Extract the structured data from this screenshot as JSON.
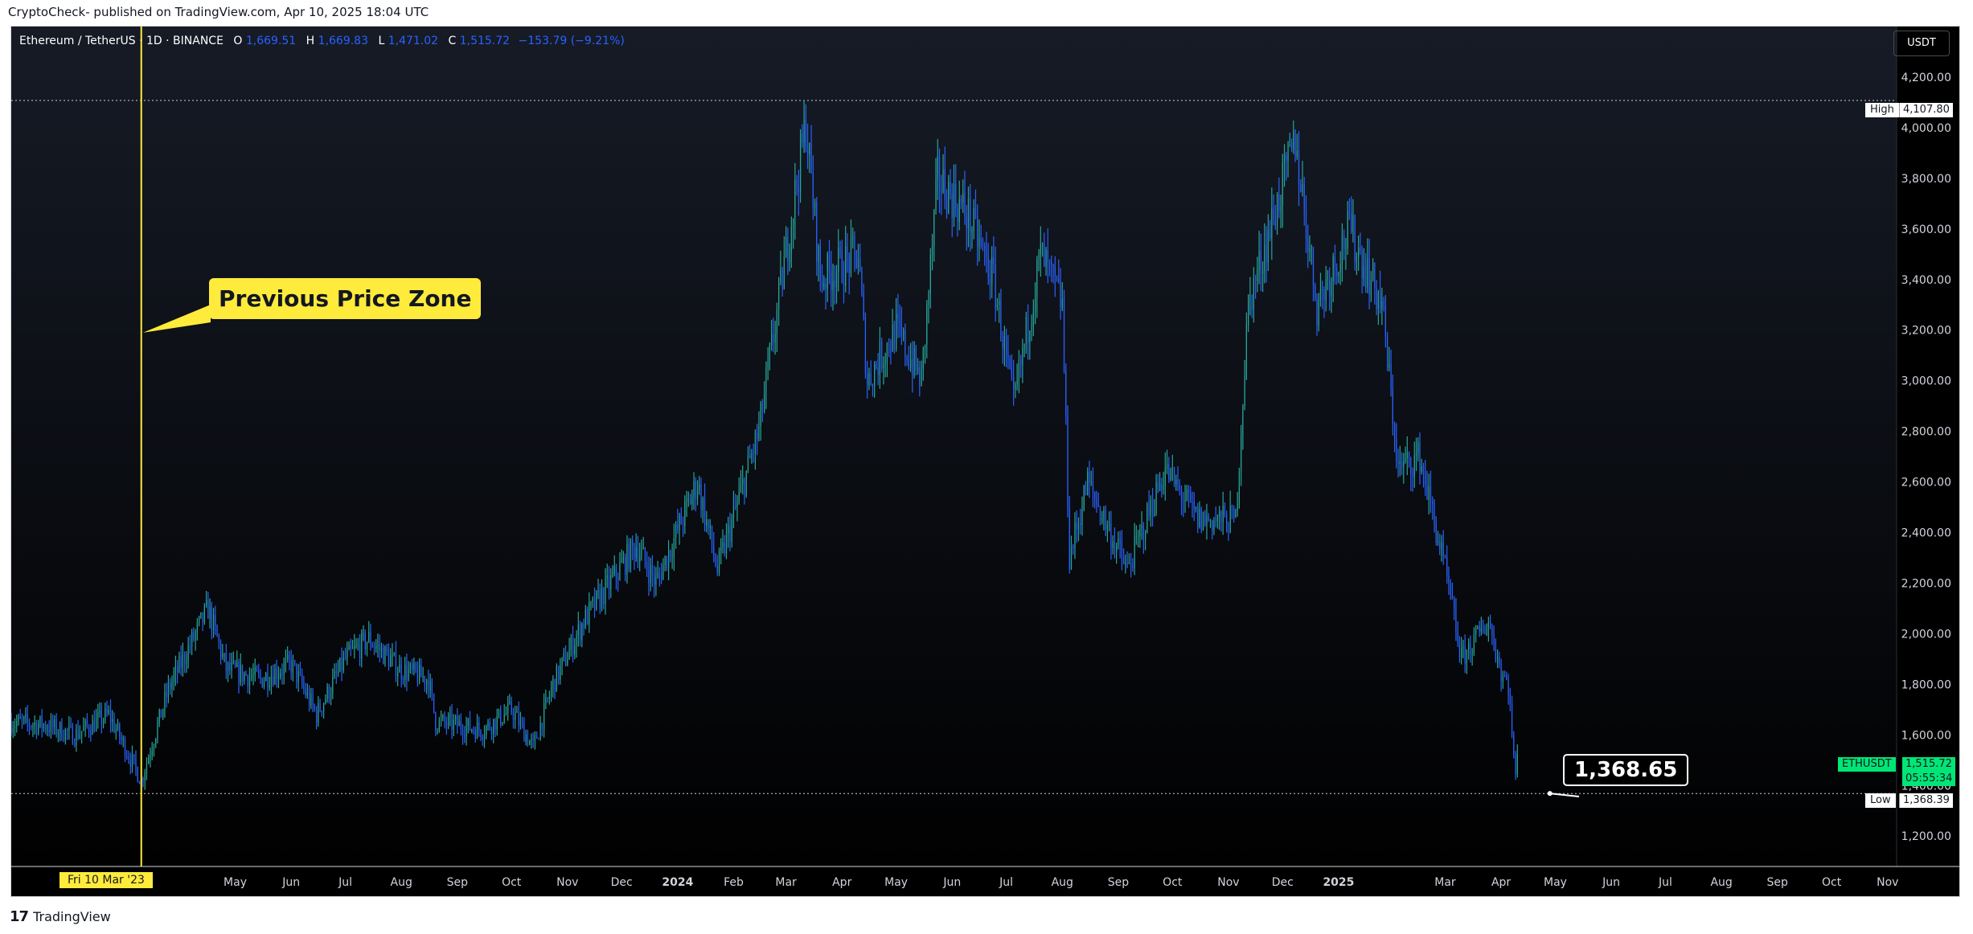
{
  "publisher": "CryptoCheck- published on TradingView.com, Apr 10, 2025 18:04 UTC",
  "header": {
    "symbol": "Ethereum / TetherUS · 1D · BINANCE",
    "o_label": "O",
    "o": "1,669.51",
    "h_label": "H",
    "h": "1,669.83",
    "l_label": "L",
    "l": "1,471.02",
    "c_label": "C",
    "c": "1,515.72",
    "change": "−153.79 (−9.21%)"
  },
  "currency_button": "USDT",
  "annotation": "Previous Price Zone",
  "callout": "1,368.65",
  "date_badge": "Fri 10 Mar '23",
  "high_tag": {
    "label": "High",
    "value": "4,107.80"
  },
  "low_tag": {
    "label": "Low",
    "value": "1,368.39"
  },
  "last_tag": {
    "symbol": "ETHUSDT",
    "value": "1,515.72",
    "countdown": "05:55:34"
  },
  "footer": {
    "logo": "17",
    "brand": "TradingView"
  },
  "colors": {
    "up": "#26a69a",
    "down": "#2962ff",
    "accent": "#ffeb3b",
    "last": "#00e676"
  },
  "chart_data": {
    "type": "candlestick",
    "title": "Ethereum / TetherUS · 1D · BINANCE",
    "x_tick_labels": [
      "Fri 10 Mar '23",
      "May",
      "Jun",
      "Jul",
      "Aug",
      "Sep",
      "Oct",
      "Nov",
      "Dec",
      "2024",
      "Feb",
      "Mar",
      "Apr",
      "May",
      "Jun",
      "Jul",
      "Aug",
      "Sep",
      "Oct",
      "Nov",
      "Dec",
      "2025",
      "Mar",
      "Apr",
      "May",
      "Jun",
      "Jul",
      "Aug",
      "Sep",
      "Oct",
      "Nov"
    ],
    "x_tick_dates": [
      "2023-03-10",
      "2023-05-01",
      "2023-06-01",
      "2023-07-01",
      "2023-08-01",
      "2023-09-01",
      "2023-10-01",
      "2023-11-01",
      "2023-12-01",
      "2024-01-01",
      "2024-02-01",
      "2024-03-01",
      "2024-04-01",
      "2024-05-01",
      "2024-06-01",
      "2024-07-01",
      "2024-08-01",
      "2024-09-01",
      "2024-10-01",
      "2024-11-01",
      "2024-12-01",
      "2025-01-01",
      "2025-03-01",
      "2025-04-01",
      "2025-05-01",
      "2025-06-01",
      "2025-07-01",
      "2025-08-01",
      "2025-09-01",
      "2025-10-01",
      "2025-11-01"
    ],
    "y_ticks": [
      1200,
      1400,
      1600,
      1800,
      2000,
      2200,
      2400,
      2600,
      2800,
      3000,
      3200,
      3400,
      3600,
      3800,
      4000,
      4200
    ],
    "ylim": [
      1080,
      4400
    ],
    "xlim": [
      "2022-12-28",
      "2025-11-06"
    ],
    "high": 4107.8,
    "low": 1368.39,
    "last": 1515.72,
    "marker_date": "2023-03-10",
    "annotation_target": [
      "2023-03-10",
      3190
    ],
    "callout_target": [
      "2025-04-28",
      1368.65
    ],
    "price_path": [
      [
        "2022-12-28",
        1650
      ],
      [
        "2023-01-15",
        1640
      ],
      [
        "2023-02-01",
        1600
      ],
      [
        "2023-02-20",
        1680
      ],
      [
        "2023-03-10",
        1420
      ],
      [
        "2023-03-25",
        1780
      ],
      [
        "2023-04-16",
        2100
      ],
      [
        "2023-04-26",
        1860
      ],
      [
        "2023-05-15",
        1820
      ],
      [
        "2023-06-01",
        1880
      ],
      [
        "2023-06-15",
        1680
      ],
      [
        "2023-07-01",
        1900
      ],
      [
        "2023-07-14",
        1980
      ],
      [
        "2023-07-31",
        1860
      ],
      [
        "2023-08-16",
        1820
      ],
      [
        "2023-08-20",
        1650
      ],
      [
        "2023-09-01",
        1640
      ],
      [
        "2023-09-15",
        1620
      ],
      [
        "2023-10-01",
        1700
      ],
      [
        "2023-10-13",
        1550
      ],
      [
        "2023-10-24",
        1800
      ],
      [
        "2023-11-10",
        2050
      ],
      [
        "2023-12-09",
        2350
      ],
      [
        "2023-12-20",
        2200
      ],
      [
        "2024-01-12",
        2600
      ],
      [
        "2024-01-23",
        2250
      ],
      [
        "2024-02-15",
        2800
      ],
      [
        "2024-03-12",
        4020
      ],
      [
        "2024-03-20",
        3400
      ],
      [
        "2024-04-10",
        3500
      ],
      [
        "2024-04-15",
        3000
      ],
      [
        "2024-05-01",
        3200
      ],
      [
        "2024-05-15",
        3000
      ],
      [
        "2024-05-24",
        3800
      ],
      [
        "2024-06-10",
        3650
      ],
      [
        "2024-06-24",
        3400
      ],
      [
        "2024-07-05",
        2900
      ],
      [
        "2024-07-20",
        3500
      ],
      [
        "2024-08-01",
        3300
      ],
      [
        "2024-08-05",
        2300
      ],
      [
        "2024-08-15",
        2600
      ],
      [
        "2024-09-06",
        2250
      ],
      [
        "2024-09-27",
        2650
      ],
      [
        "2024-10-15",
        2450
      ],
      [
        "2024-11-05",
        2450
      ],
      [
        "2024-11-12",
        3300
      ],
      [
        "2024-12-08",
        3950
      ],
      [
        "2024-12-20",
        3300
      ],
      [
        "2025-01-07",
        3600
      ],
      [
        "2025-01-25",
        3300
      ],
      [
        "2025-02-03",
        2650
      ],
      [
        "2025-02-15",
        2700
      ],
      [
        "2025-03-01",
        2250
      ],
      [
        "2025-03-10",
        1900
      ],
      [
        "2025-03-25",
        2050
      ],
      [
        "2025-04-01",
        1850
      ],
      [
        "2025-04-05",
        1800
      ],
      [
        "2025-04-09",
        1420
      ],
      [
        "2025-04-10",
        1515.72
      ]
    ]
  }
}
